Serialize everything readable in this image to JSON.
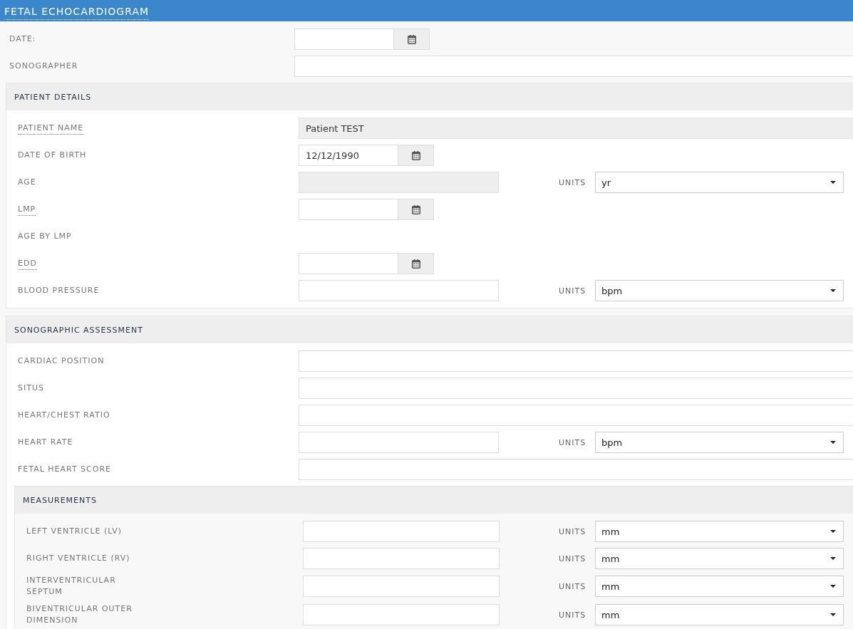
{
  "title": "FETAL ECHOCARDIOGRAM",
  "fields": [
    {
      "label": "DATE:",
      "kind": "date",
      "tooltip": false
    },
    {
      "label": "SONOGRAPHER",
      "kind": "text",
      "tooltip": false
    }
  ],
  "sections": [
    {
      "title": "PATIENT DETAILS",
      "fields": [
        {
          "label": "PATIENT NAME",
          "kind": "static",
          "value": "Patient TEST",
          "tooltip": true
        },
        {
          "label": "DATE OF BIRTH",
          "kind": "date",
          "value": "12/12/1990",
          "tooltip": false
        },
        {
          "label": "AGE",
          "kind": "static_units",
          "units": {
            "label": "UNITS",
            "value": "yr"
          },
          "tooltip": false
        },
        {
          "label": "LMP",
          "kind": "date",
          "tooltip": true
        },
        {
          "label": "AGE BY LMP",
          "kind": "plain",
          "tooltip": false
        },
        {
          "label": "EDD",
          "kind": "date",
          "tooltip": true
        },
        {
          "label": "BLOOD PRESSURE",
          "kind": "units",
          "units": {
            "label": "UNITS",
            "value": "bpm"
          },
          "tooltip": false
        }
      ]
    },
    {
      "title": "SONOGRAPHIC ASSESSMENT",
      "fields": [
        {
          "label": "CARDIAC POSITION",
          "kind": "text",
          "tooltip": false
        },
        {
          "label": "SITUS",
          "kind": "text",
          "tooltip": false
        },
        {
          "label": "HEART/CHEST RATIO",
          "kind": "text",
          "tooltip": false
        },
        {
          "label": "HEART RATE",
          "kind": "units",
          "units": {
            "label": "UNITS",
            "value": "bpm"
          },
          "tooltip": false
        },
        {
          "label": "FETAL HEART SCORE",
          "kind": "text",
          "tooltip": false
        }
      ],
      "subsections": [
        {
          "title": "MEASUREMENTS",
          "fields": [
            {
              "label": "LEFT VENTRICLE (LV)",
              "kind": "units",
              "units": {
                "label": "UNITS",
                "value": "mm"
              },
              "tooltip": false
            },
            {
              "label": "RIGHT VENTRICLE (RV)",
              "kind": "units",
              "units": {
                "label": "UNITS",
                "value": "mm"
              },
              "tooltip": false
            },
            {
              "label": "INTERVENTRICULAR SEPTUM",
              "kind": "units",
              "units": {
                "label": "UNITS",
                "value": "mm"
              },
              "tooltip": false
            },
            {
              "label": "BIVENTRICULAR OUTER DIMENSION",
              "kind": "units",
              "units": {
                "label": "UNITS",
                "value": "mm"
              },
              "tooltip": false
            }
          ]
        }
      ]
    }
  ]
}
